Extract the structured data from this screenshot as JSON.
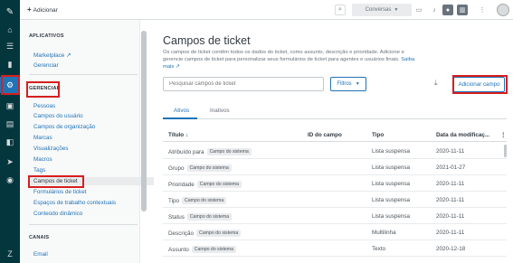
{
  "topbar": {
    "add_label": "Adicionar",
    "conversations_label": "Conversas"
  },
  "adminnav": {
    "sections": [
      {
        "title": "APLICATIVOS",
        "links": [
          "Marketplace",
          "Gerenciar"
        ]
      },
      {
        "title": "GERENCIAR",
        "links": [
          "Pessoas",
          "Campos do usuário",
          "Campos de organização",
          "Marcas",
          "Visualizações",
          "Macros",
          "Tags",
          "Campos de ticket",
          "Formulários de ticket",
          "Espaços de trabalho contextuais",
          "Conteúdo dinâmico"
        ]
      },
      {
        "title": "CANAIS",
        "links": [
          "Email"
        ]
      }
    ],
    "selected": "Campos de ticket"
  },
  "main": {
    "title": "Campos de ticket",
    "description": "Os campos de ticket contêm todos os dados do ticket, como assunto, descrição e prioridade. Adicione e gerencie campos de ticket para personalizar seus formulários de ticket para agentes e usuários finais.",
    "learn_more": "Saiba mais",
    "search_placeholder": "Pesquisar campos de ticket",
    "filters_label": "Filtros",
    "add_field_label": "Adicionar campo",
    "tabs": [
      "Ativos",
      "Inativos"
    ],
    "columns": [
      "Título",
      "ID do campo",
      "Tipo",
      "Data da modificaç..."
    ],
    "rows": [
      {
        "title": "Atribuído para",
        "tag": "Campo do sistema",
        "id": "",
        "type": "Lista suspensa",
        "date": "2020-11-11"
      },
      {
        "title": "Grupo",
        "tag": "Campo do sistema",
        "id": "",
        "type": "Lista suspensa",
        "date": "2021-01-27"
      },
      {
        "title": "Prioridade",
        "tag": "Campo do sistema",
        "id": "",
        "type": "Lista suspensa",
        "date": "2020-11-11"
      },
      {
        "title": "Tipo",
        "tag": "Campo do sistema",
        "id": "",
        "type": "Lista suspensa",
        "date": "2020-11-11"
      },
      {
        "title": "Status",
        "tag": "Campo do sistema",
        "id": "",
        "type": "Lista suspensa",
        "date": "2020-11-11"
      },
      {
        "title": "Descrição",
        "tag": "Campo do sistema",
        "id": "",
        "type": "Multilinha",
        "date": "2020-11-11"
      },
      {
        "title": "Assunto",
        "tag": "Campo do sistema",
        "id": "",
        "type": "Texto",
        "date": "2020-12-18"
      }
    ]
  }
}
